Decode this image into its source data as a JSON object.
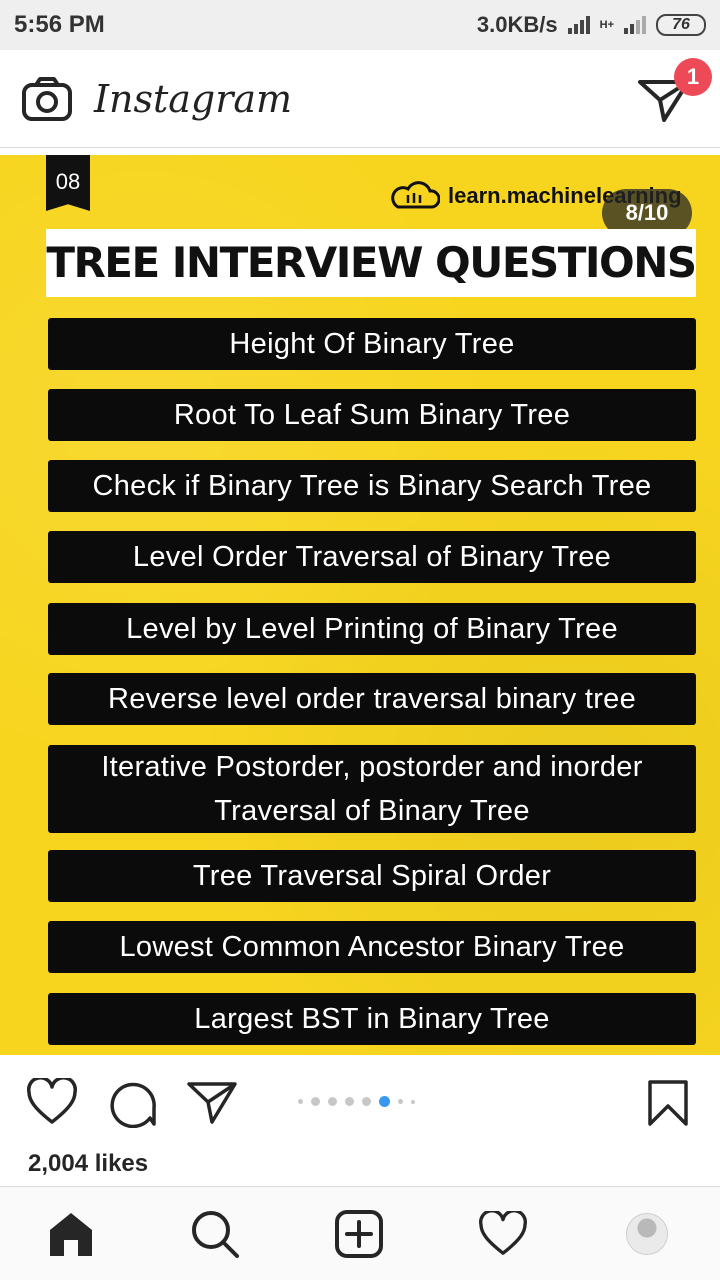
{
  "status_bar": {
    "time": "5:56 PM",
    "network_speed": "3.0KB/s",
    "network_type": "H+",
    "battery": "76"
  },
  "header": {
    "app_name": "Instagram",
    "notification_count": "1"
  },
  "post": {
    "badge": "08",
    "brand": "learn.machinelearning",
    "counter": "8/10",
    "title": "TREE INTERVIEW QUESTIONS",
    "items": [
      "Height Of Binary Tree",
      "Root To Leaf Sum Binary Tree",
      "Check if Binary Tree is Binary Search Tree",
      "Level Order Traversal of Binary Tree",
      "Level by Level Printing of Binary Tree",
      "Reverse level order traversal binary tree",
      "Iterative Postorder, postorder and inorder Traversal of Binary Tree",
      "Tree Traversal Spiral Order",
      "Lowest Common Ancestor Binary Tree",
      "Largest BST in Binary Tree"
    ],
    "likes": "2,004 likes",
    "carousel": {
      "total_dots": 8,
      "active_index": 5
    }
  },
  "colors": {
    "accent": "#f7d51f",
    "badge": "#ed4956",
    "active_dot": "#3897f0"
  },
  "icons": [
    "camera-icon",
    "direct-message-icon",
    "heart-icon",
    "comment-icon",
    "share-icon",
    "bookmark-icon",
    "home-icon",
    "search-icon",
    "add-post-icon",
    "activity-icon",
    "profile-avatar"
  ]
}
